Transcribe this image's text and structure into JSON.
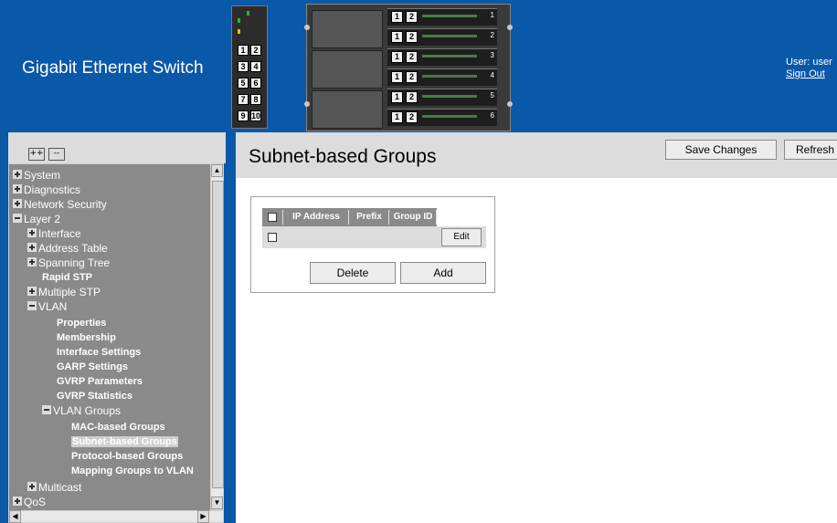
{
  "header": {
    "title": "Gigabit Ethernet Switch",
    "user_label": "User: user",
    "sign_out": "Sign Out",
    "switch_ports": [
      "1",
      "2",
      "3",
      "4",
      "5",
      "6",
      "7",
      "8",
      "9",
      "10"
    ],
    "chassis_slots": [
      "1",
      "2",
      "3",
      "4",
      "5",
      "6"
    ],
    "colors": {
      "header_bg": "#0a58a8",
      "led_green": "#20c020",
      "led_amber": "#e0c000"
    }
  },
  "sidebar": {
    "expand_all": "++",
    "collapse_all": "--",
    "items": [
      {
        "label": "System",
        "icon": "plus-icon"
      },
      {
        "label": "Diagnostics",
        "icon": "plus-icon"
      },
      {
        "label": "Network Security",
        "icon": "plus-icon"
      },
      {
        "label": "Layer 2",
        "icon": "minus-icon"
      },
      {
        "label": "Interface",
        "icon": "plus-icon"
      },
      {
        "label": "Address Table",
        "icon": "plus-icon"
      },
      {
        "label": "Spanning Tree",
        "icon": "plus-icon"
      },
      {
        "label": "Rapid STP"
      },
      {
        "label": "Multiple STP",
        "icon": "plus-icon"
      },
      {
        "label": "VLAN",
        "icon": "minus-icon"
      },
      {
        "label": "Properties"
      },
      {
        "label": "Membership"
      },
      {
        "label": "Interface Settings"
      },
      {
        "label": "GARP Settings"
      },
      {
        "label": "GVRP Parameters"
      },
      {
        "label": "GVRP Statistics"
      },
      {
        "label": "VLAN Groups",
        "icon": "minus-icon"
      },
      {
        "label": "MAC-based Groups"
      },
      {
        "label": "Subnet-based Groups",
        "selected": true
      },
      {
        "label": "Protocol-based Groups"
      },
      {
        "label": "Mapping Groups to VLAN"
      },
      {
        "label": "Multicast",
        "icon": "plus-icon"
      },
      {
        "label": "QoS",
        "icon": "plus-icon"
      }
    ]
  },
  "main": {
    "title": "Subnet-based Groups",
    "save_label": "Save Changes",
    "refresh_label": "Refresh",
    "table": {
      "columns": [
        "IP Address",
        "Prefix",
        "Group ID"
      ],
      "rows": [
        {
          "edit_label": "Edit"
        }
      ]
    },
    "delete_label": "Delete",
    "add_label": "Add"
  }
}
